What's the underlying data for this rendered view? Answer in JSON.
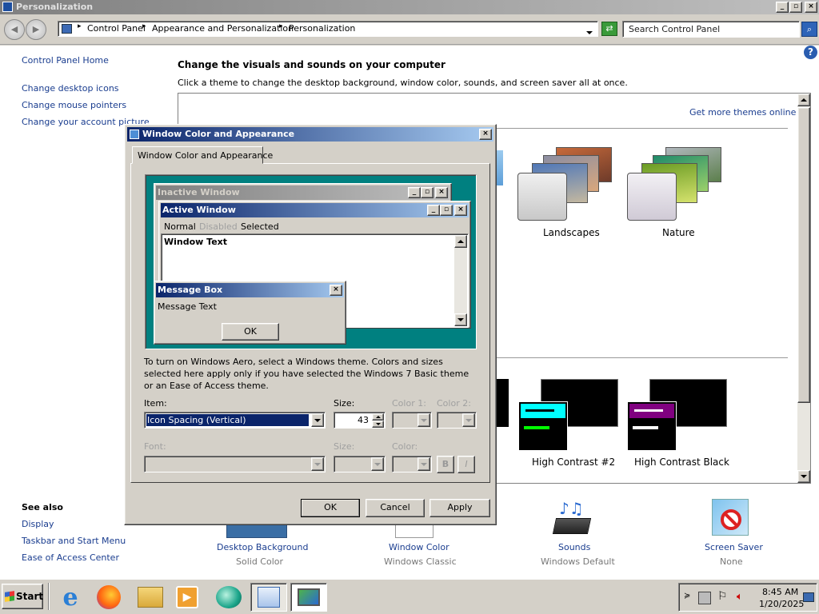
{
  "window": {
    "title": "Personalization"
  },
  "address": {
    "crumbs": [
      "Control Panel",
      "Appearance and Personalization",
      "Personalization"
    ],
    "search_placeholder": "Search Control Panel"
  },
  "sidebar": {
    "home": "Control Panel Home",
    "links": [
      "Change desktop icons",
      "Change mouse pointers",
      "Change your account picture"
    ],
    "see_also_title": "See also",
    "see_also": [
      "Display",
      "Taskbar and Start Menu",
      "Ease of Access Center"
    ]
  },
  "main": {
    "heading": "Change the visuals and sounds on your computer",
    "subheading": "Click a theme to change the desktop background, window color, sounds, and screen saver all at once.",
    "more_themes": "Get more themes online",
    "themes": [
      "Landscapes",
      "Nature"
    ],
    "contrast_themes": [
      "High Contrast #2",
      "High Contrast Black"
    ],
    "bottom": [
      {
        "label": "Desktop Background",
        "value": "Solid Color"
      },
      {
        "label": "Window Color",
        "value": "Windows Classic"
      },
      {
        "label": "Sounds",
        "value": "Windows Default"
      },
      {
        "label": "Screen Saver",
        "value": "None"
      }
    ]
  },
  "dialog": {
    "title": "Window Color and Appearance",
    "tab": "Window Color and Appearance",
    "preview": {
      "inactive": "Inactive Window",
      "active": "Active Window",
      "menu": [
        "Normal",
        "Disabled",
        "Selected"
      ],
      "window_text": "Window Text",
      "msgbox_title": "Message Box",
      "msgbox_text": "Message Text",
      "ok": "OK"
    },
    "info": "To turn on Windows Aero, select a Windows theme.  Colors and sizes selected here apply only if you have selected the Windows 7 Basic theme or an Ease of Access theme.",
    "item_label": "Item:",
    "item_value": "Icon Spacing (Vertical)",
    "size_label": "Size:",
    "size_value": "43",
    "color1_label": "Color 1:",
    "color2_label": "Color 2:",
    "font_label": "Font:",
    "font_size_label": "Size:",
    "font_color_label": "Color:",
    "bold": "B",
    "italic": "I",
    "ok": "OK",
    "cancel": "Cancel",
    "apply": "Apply"
  },
  "taskbar": {
    "start": "Start",
    "time": "8:45 AM",
    "date": "1/20/2025"
  },
  "colors": {
    "titlebar_active": "#0a246a",
    "titlebar_active_end": "#a6caf0",
    "titlebar_inactive": "#808080",
    "preview_bg": "#008080",
    "selection": "#0a246a"
  }
}
